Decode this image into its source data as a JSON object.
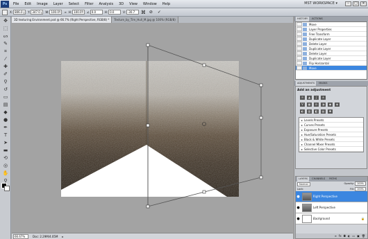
{
  "app_logo": "Ps",
  "menu": [
    "File",
    "Edit",
    "Image",
    "Layer",
    "Select",
    "Filter",
    "Analysis",
    "3D",
    "View",
    "Window",
    "Help"
  ],
  "workspace_label": "MST WORKSPACE ▾",
  "options": {
    "x_label": "X:",
    "x_value": "806.0 px",
    "y_label": "Y:",
    "y_value": "347.0 px",
    "w_label": "W:",
    "w_value": "100.0%",
    "h_label": "H:",
    "h_value": "100.0%",
    "angle_value": "0.0",
    "h_skew_label": "H:",
    "h_skew_value": "0.0",
    "v_skew_label": "V:",
    "v_skew_value": "-30.7"
  },
  "tabs": [
    {
      "label": "3D texturing Environment.psd @ 66.7% (Right Perspective, RGB/8) *",
      "active": true
    },
    {
      "label": "Texture_by_Tim_Hull_M.jpg @ 100% (RGB/8)",
      "active": false
    }
  ],
  "status": {
    "zoom": "66.67%",
    "doc": "Doc: 2.29M/4.05M"
  },
  "history": {
    "tabs": [
      "HISTORY",
      "ACTIONS"
    ],
    "items": [
      "Move",
      "Layer Properties",
      "Free Transform",
      "Duplicate Layer",
      "Delete Layer",
      "Duplicate Layer",
      "Delete Layer",
      "Duplicate Layer",
      "Flip Horizontal",
      "Move"
    ]
  },
  "adjustments": {
    "tabs": [
      "ADJUSTMENTS",
      "MASKS"
    ],
    "title": "Add an adjustment",
    "presets": [
      "Levels Presets",
      "Curves Presets",
      "Exposure Presets",
      "Hue/Saturation Presets",
      "Black & White Presets",
      "Channel Mixer Presets",
      "Selective Color Presets"
    ]
  },
  "layers": {
    "tabs": [
      "LAYERS",
      "CHANNELS",
      "PATHS"
    ],
    "blend_mode": "Normal",
    "opacity_label": "Opacity:",
    "opacity": "100%",
    "fill_label": "Fill:",
    "fill": "100%",
    "lock_label": "Lock:",
    "items": [
      {
        "name": "Right Perspective",
        "selected": true
      },
      {
        "name": "Left Perspective",
        "selected": false
      },
      {
        "name": "Background",
        "selected": false
      }
    ]
  },
  "colors": {
    "selection": "#3b86e0",
    "canvas_bg": "#a3a3a3"
  }
}
